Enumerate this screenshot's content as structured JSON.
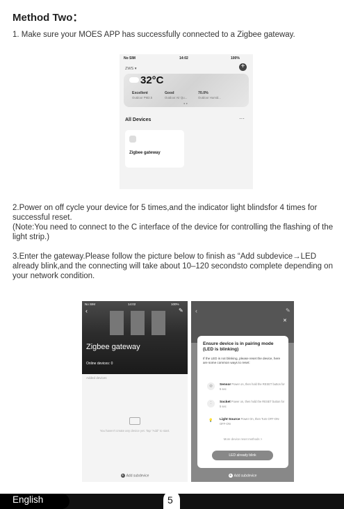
{
  "title": "Method Two：",
  "step1": "1. Make sure your MOES APP has successfully connected to a Zigbee gateway.",
  "step2": "2.Power on off cycle your device for 5 times,and the indicator light blindsfor 4 times for successful reset.",
  "step2_note": "(Note:You need to connect to the C interface of the device for controlling the flashing of the light strip.)",
  "step3": "3.Enter the gateway.Please follow the picture below to finish as “Add subdevice→LED already blink,and the connecting will take about 10–120 secondsto complete depending on your network condition.",
  "phone1": {
    "carrier": "No SIM",
    "time": "14:02",
    "battery": "100%",
    "home_name": "ZWS",
    "temperature": "32°C",
    "weather": [
      {
        "value": "Excellent",
        "label": "Outdoor PM2.5"
      },
      {
        "value": "Good",
        "label": "Outdoor Air Qu..."
      },
      {
        "value": "70.0%",
        "label": "Outdoor Humid..."
      }
    ],
    "all_devices": "All Devices",
    "more": "···",
    "device_name": "Zigbee gateway"
  },
  "phone2": {
    "carrier": "No SIM",
    "time": "14:02",
    "battery": "100%",
    "gateway_name": "Zigbee gateway",
    "online_devices": "Online devices: 0",
    "added_devices": "Added devices",
    "empty_text": "You haven't create any device yet. Tap \"Add\" to start.",
    "add_subdevice": "Add subdevice"
  },
  "phone3": {
    "modal_title": "Ensure device is in pairing mode (LED is blinking)",
    "modal_desc": "If the LED is not blinking, please reset the device, here are some common ways to reset:",
    "methods": [
      {
        "name": "Sensor",
        "desc": "Power on, then hold the RESET button for 5 sec"
      },
      {
        "name": "Socket",
        "desc": "Power on, then hold the RESET button for 5 sec"
      },
      {
        "name": "Light Source",
        "desc": "Power On, then Turn OFF-ON-OFF-ON"
      }
    ],
    "more_methods": "More device reset methods >",
    "button": "LED already blink",
    "add_subdevice": "Add subdevice"
  },
  "footer": {
    "language": "English",
    "page": "5"
  }
}
